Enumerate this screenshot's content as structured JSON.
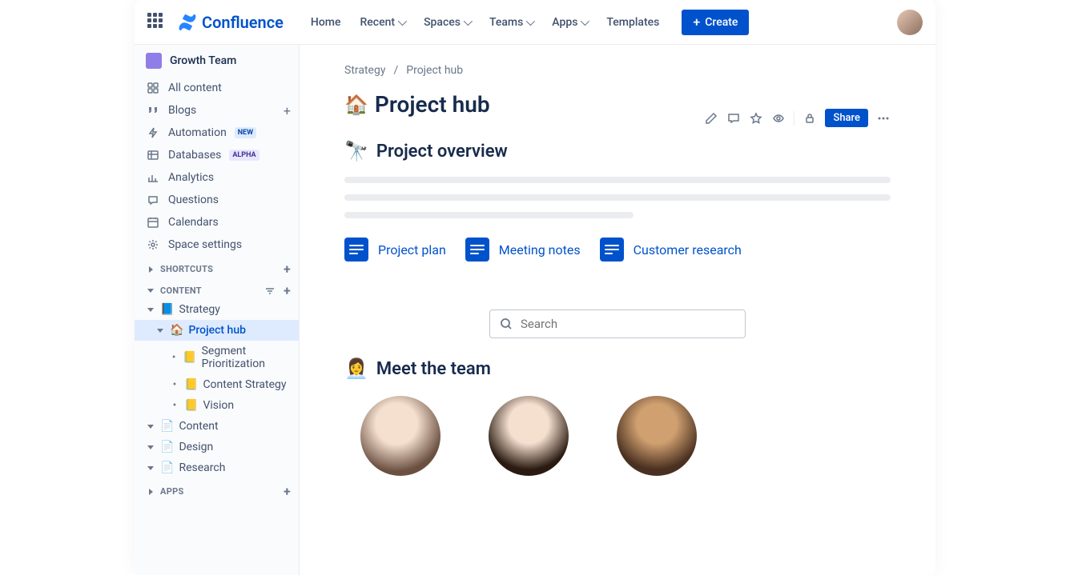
{
  "product_name": "Confluence",
  "nav": {
    "home": "Home",
    "recent": "Recent",
    "spaces": "Spaces",
    "teams": "Teams",
    "apps": "Apps",
    "templates": "Templates",
    "create": "Create"
  },
  "space": {
    "name": "Growth Team"
  },
  "sidebar": {
    "all_content": "All content",
    "blogs": "Blogs",
    "automation": "Automation",
    "automation_badge": "NEW",
    "databases": "Databases",
    "databases_badge": "ALPHA",
    "analytics": "Analytics",
    "questions": "Questions",
    "calendars": "Calendars",
    "space_settings": "Space settings",
    "shortcuts_header": "SHORTCUTS",
    "content_header": "CONTENT",
    "apps_header": "APPS"
  },
  "tree": {
    "strategy": "Strategy",
    "project_hub": "Project hub",
    "segment_prioritization": "Segment Prioritization",
    "content_strategy": "Content Strategy",
    "vision": "Vision",
    "content": "Content",
    "design": "Design",
    "research": "Research"
  },
  "breadcrumb": {
    "parent": "Strategy",
    "current": "Project hub"
  },
  "page": {
    "title_emoji": "🏠",
    "title": "Project hub",
    "overview_emoji": "🔭",
    "overview": "Project overview",
    "team_emoji": "👩‍💼",
    "team": "Meet the team",
    "share": "Share"
  },
  "cards": {
    "plan": "Project plan",
    "notes": "Meeting notes",
    "research": "Customer research"
  },
  "search": {
    "placeholder": "Search"
  }
}
